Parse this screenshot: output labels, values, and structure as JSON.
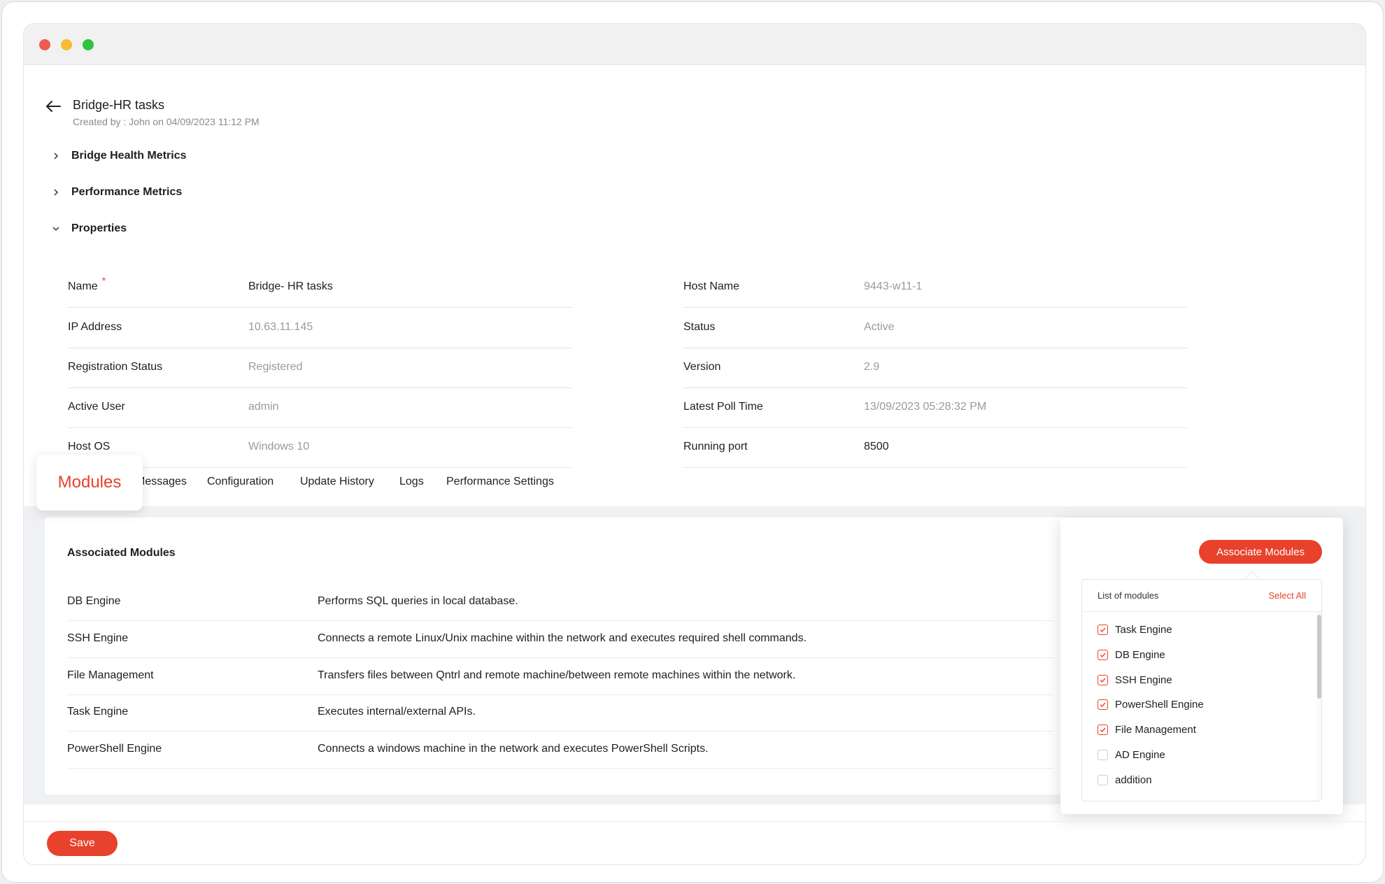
{
  "header": {
    "title": "Bridge-HR tasks",
    "subtitle": "Created by : John on 04/09/2023 11:12 PM"
  },
  "sections": [
    {
      "label": "Bridge Health Metrics",
      "expanded": false
    },
    {
      "label": "Performance Metrics",
      "expanded": false
    },
    {
      "label": "Properties",
      "expanded": true
    }
  ],
  "properties": {
    "left": [
      {
        "key": "Name",
        "value": "Bridge- HR tasks",
        "required": true
      },
      {
        "key": "IP Address",
        "value": "10.63.11.145"
      },
      {
        "key": "Registration Status",
        "value": "Registered"
      },
      {
        "key": "Active User",
        "value": "admin"
      },
      {
        "key": "Host OS",
        "value": "Windows 10"
      }
    ],
    "right": [
      {
        "key": "Host Name",
        "value": "9443-w11-1"
      },
      {
        "key": "Status",
        "value": "Active"
      },
      {
        "key": "Version",
        "value": "2.9"
      },
      {
        "key": "Latest Poll Time",
        "value": "13/09/2023 05:28:32 PM"
      },
      {
        "key": "Running port",
        "value": "8500"
      }
    ]
  },
  "tabs": {
    "active": "Modules",
    "partial": "Messages",
    "items": [
      "Configuration",
      "Update History",
      "Logs",
      "Performance Settings"
    ]
  },
  "modules": {
    "title": "Associated Modules",
    "rows": [
      {
        "name": "DB Engine",
        "desc": "Performs SQL queries in local database."
      },
      {
        "name": "SSH Engine",
        "desc": "Connects a remote Linux/Unix machine within the network and executes required shell commands."
      },
      {
        "name": "File Management",
        "desc": "Transfers files between Qntrl and remote machine/between remote machines within the network."
      },
      {
        "name": "Task Engine",
        "desc": "Executes internal/external APIs."
      },
      {
        "name": "PowerShell Engine",
        "desc": "Connects a windows machine in the network and executes PowerShell Scripts."
      }
    ]
  },
  "popover": {
    "button": "Associate Modules",
    "list_title": "List of modules",
    "select_all": "Select All",
    "options": [
      {
        "label": "Task Engine",
        "checked": true
      },
      {
        "label": "DB Engine",
        "checked": true
      },
      {
        "label": "SSH Engine",
        "checked": true
      },
      {
        "label": "PowerShell Engine",
        "checked": true
      },
      {
        "label": "File Management",
        "checked": true
      },
      {
        "label": "AD Engine",
        "checked": false
      },
      {
        "label": "addition",
        "checked": false
      }
    ]
  },
  "footer": {
    "save": "Save"
  },
  "colors": {
    "accent": "#e8412c",
    "muted_text": "#9a9a9a",
    "gray_bg": "#f0f1f4"
  },
  "icons": [
    "arrow-left-icon",
    "chevron-right-icon",
    "chevron-down-icon",
    "checkbox-checked-icon",
    "checkbox-empty-icon"
  ]
}
